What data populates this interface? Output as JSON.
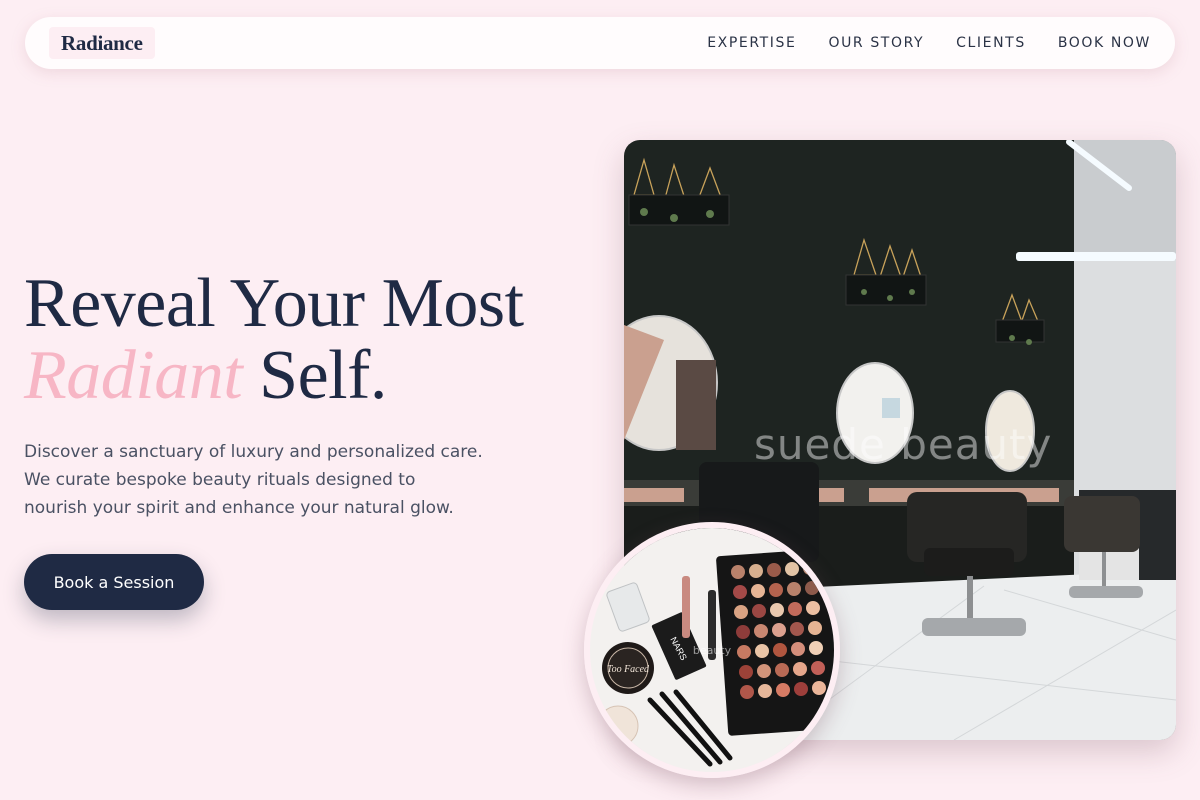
{
  "nav": {
    "logo": "Radiance",
    "links": [
      "EXPERTISE",
      "OUR STORY",
      "CLIENTS",
      "BOOK NOW"
    ]
  },
  "hero": {
    "headline_line1": "Reveal Your Most",
    "headline_accent": "Radiant",
    "headline_rest": "Self.",
    "description": "Discover a sanctuary of luxury and personalized care. We curate bespoke beauty rituals designed to nourish your spirit and enhance your natural glow.",
    "cta_label": "Book a Session"
  },
  "images": {
    "salon_watermark": "suede beauty",
    "makeup_brand_label": "Too Faced",
    "makeup_product_label": "NARS",
    "makeup_watermark": "beauty"
  },
  "colors": {
    "background": "#fdeef3",
    "navy": "#1f2a44",
    "accent_pink": "#f7b6c5"
  }
}
